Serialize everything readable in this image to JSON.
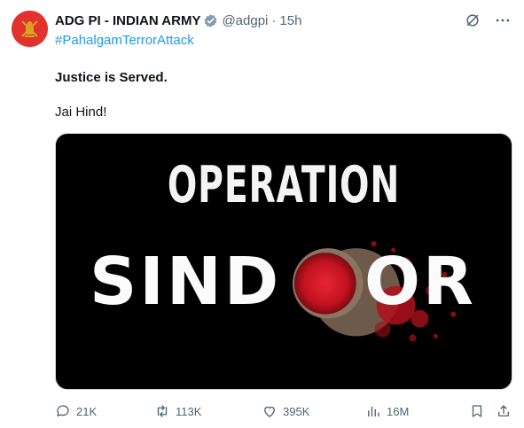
{
  "account": {
    "display_name": "ADG PI - INDIAN ARMY",
    "handle": "@adgpi",
    "separator": "·",
    "time": "15h"
  },
  "post": {
    "hashtag": "#PahalgamTerrorAttack",
    "line1": "Justice is Served.",
    "line2": "Jai Hind!"
  },
  "media": {
    "word_top": "OPERATION",
    "word_bottom_left": "SIND",
    "word_bottom_right": "OR"
  },
  "stats": {
    "replies": "21K",
    "reposts": "113K",
    "likes": "395K",
    "views": "16M"
  },
  "colors": {
    "link": "#1d9bf0",
    "muted": "#536471",
    "avatar_bg": "#e3312d",
    "verified_badge": "#829aab"
  },
  "icons": [
    "army-emblem-avatar",
    "verified-badge-icon",
    "grok-icon",
    "more-icon",
    "reply-icon",
    "repost-icon",
    "like-icon",
    "views-icon",
    "bookmark-icon",
    "share-icon"
  ]
}
